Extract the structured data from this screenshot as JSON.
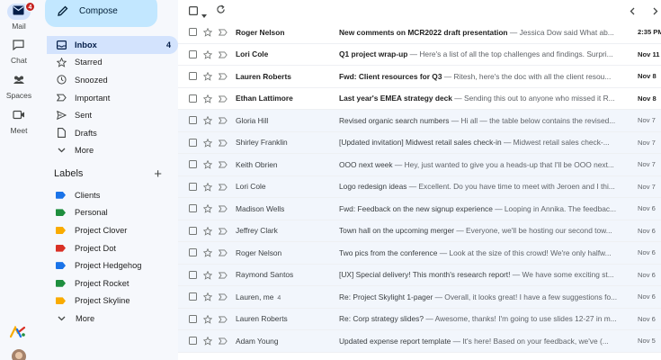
{
  "rail": {
    "items": [
      {
        "label": "Mail",
        "badge": "4"
      },
      {
        "label": "Chat"
      },
      {
        "label": "Spaces"
      },
      {
        "label": "Meet"
      }
    ]
  },
  "sidebar": {
    "compose_label": "Compose",
    "nav": [
      {
        "label": "Inbox",
        "count": "4",
        "icon": "inbox-icon"
      },
      {
        "label": "Starred",
        "icon": "star-icon"
      },
      {
        "label": "Snoozed",
        "icon": "clock-icon"
      },
      {
        "label": "Important",
        "icon": "important-icon"
      },
      {
        "label": "Sent",
        "icon": "send-icon"
      },
      {
        "label": "Drafts",
        "icon": "draft-icon"
      },
      {
        "label": "More",
        "icon": "chevron-down-icon"
      }
    ],
    "labels_title": "Labels",
    "labels": [
      {
        "label": "Clients",
        "color": "#1a73e8"
      },
      {
        "label": "Personal",
        "color": "#1e8e3e"
      },
      {
        "label": "Project Clover",
        "color": "#f9ab00"
      },
      {
        "label": "Project Dot",
        "color": "#d93025"
      },
      {
        "label": "Project Hedgehog",
        "color": "#1a73e8"
      },
      {
        "label": "Project Rocket",
        "color": "#1e8e3e"
      },
      {
        "label": "Project Skyline",
        "color": "#f9ab00"
      }
    ],
    "labels_more": "More"
  },
  "emails": [
    {
      "sender": "Roger Nelson",
      "subject": "New comments on MCR2022 draft presentation",
      "snippet": " — Jessica Dow said What ab...",
      "date": "2:35 PM",
      "unread": true
    },
    {
      "sender": "Lori Cole",
      "subject": "Q1 project wrap-up",
      "snippet": " — Here's a list of all the top challenges and findings. Surpri...",
      "date": "Nov 11",
      "unread": true
    },
    {
      "sender": "Lauren Roberts",
      "subject": "Fwd: Client resources for Q3",
      "snippet": " — Ritesh, here's the doc with all the client resou...",
      "date": "Nov 8",
      "unread": true
    },
    {
      "sender": "Ethan Lattimore",
      "subject": "Last year's EMEA strategy deck",
      "snippet": " — Sending this out to anyone who missed it R...",
      "date": "Nov 8",
      "unread": true
    },
    {
      "sender": "Gloria Hill",
      "subject": "Revised organic search numbers",
      "snippet": " — Hi all — the table below contains the revised...",
      "date": "Nov 7",
      "unread": false
    },
    {
      "sender": "Shirley Franklin",
      "subject": "[Updated invitation] Midwest retail sales check-in",
      "snippet": " — Midwest retail sales check-...",
      "date": "Nov 7",
      "unread": false
    },
    {
      "sender": "Keith Obrien",
      "subject": "OOO next week",
      "snippet": " — Hey, just wanted to give you a heads-up that I'll be OOO next...",
      "date": "Nov 7",
      "unread": false
    },
    {
      "sender": "Lori Cole",
      "subject": "Logo redesign ideas",
      "snippet": " — Excellent. Do you have time to meet with Jeroen and I thi...",
      "date": "Nov 7",
      "unread": false
    },
    {
      "sender": "Madison Wells",
      "subject": "Fwd: Feedback on the new signup experience",
      "snippet": " — Looping in Annika. The feedbac...",
      "date": "Nov 6",
      "unread": false
    },
    {
      "sender": "Jeffrey Clark",
      "subject": "Town hall on the upcoming merger",
      "snippet": " — Everyone, we'll be hosting our second tow...",
      "date": "Nov 6",
      "unread": false
    },
    {
      "sender": "Roger Nelson",
      "subject": "Two pics from the conference",
      "snippet": " — Look at the size of this crowd! We're only halfw...",
      "date": "Nov 6",
      "unread": false
    },
    {
      "sender": "Raymond Santos",
      "subject": "[UX] Special delivery! This month's research report!",
      "snippet": " — We have some exciting st...",
      "date": "Nov 6",
      "unread": false
    },
    {
      "sender": "Lauren, me",
      "count": "4",
      "subject": "Re: Project Skylight 1-pager",
      "snippet": " — Overall, it looks great! I have a few suggestions fo...",
      "date": "Nov 6",
      "unread": false
    },
    {
      "sender": "Lauren Roberts",
      "subject": "Re: Corp strategy slides?",
      "snippet": " — Awesome, thanks! I'm going to use slides 12-27 in m...",
      "date": "Nov 6",
      "unread": false
    },
    {
      "sender": "Adam Young",
      "subject": "Updated expense report template",
      "snippet": " — It's here! Based on your feedback, we've (...",
      "date": "Nov 5",
      "unread": false
    }
  ]
}
